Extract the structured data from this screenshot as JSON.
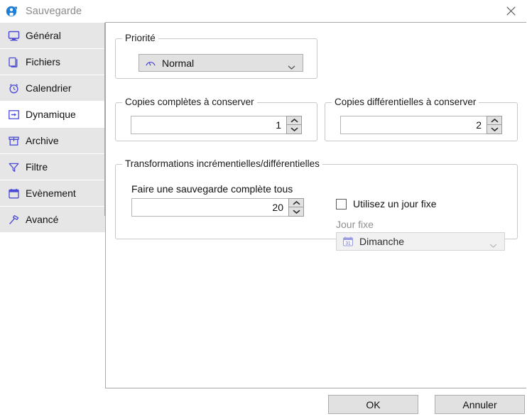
{
  "window": {
    "title": "Sauvegarde",
    "app_icon": "save-disk-icon",
    "close_icon": "close-icon"
  },
  "sidebar": {
    "items": [
      {
        "label": "Général",
        "icon": "monitor-icon",
        "selected": false
      },
      {
        "label": "Fichiers",
        "icon": "files-icon",
        "selected": false
      },
      {
        "label": "Calendrier",
        "icon": "alarm-clock-icon",
        "selected": false
      },
      {
        "label": "Dynamique",
        "icon": "arrow-box-icon",
        "selected": true
      },
      {
        "label": "Archive",
        "icon": "archive-box-icon",
        "selected": false
      },
      {
        "label": "Filtre",
        "icon": "funnel-icon",
        "selected": false
      },
      {
        "label": "Evènement",
        "icon": "calendar-icon",
        "selected": false
      },
      {
        "label": "Avancé",
        "icon": "hammer-icon",
        "selected": false
      }
    ]
  },
  "main": {
    "priority_group": {
      "title": "Priorité",
      "combo": {
        "value": "Normal",
        "icon": "gauge-icon",
        "arrow_icon": "chevron-down-icon"
      }
    },
    "full_copies_group": {
      "title": "Copies complètes à conserver",
      "spinner": {
        "value": "1",
        "up_icon": "chevron-up-icon",
        "down_icon": "chevron-down-icon"
      }
    },
    "diff_copies_group": {
      "title": "Copies différentielles à conserver",
      "spinner": {
        "value": "2",
        "up_icon": "chevron-up-icon",
        "down_icon": "chevron-down-icon"
      }
    },
    "transformations_group": {
      "title": "Transformations incrémentielles/différentielles",
      "full_backup_label": "Faire une sauvegarde complète tous",
      "full_backup_spinner": {
        "value": "20",
        "up_icon": "chevron-up-icon",
        "down_icon": "chevron-down-icon"
      },
      "fixed_day_checkbox": {
        "label": "Utilisez un jour fixe",
        "checked": false
      },
      "fixed_day_label": "Jour fixe",
      "fixed_day_combo": {
        "value": "Dimanche",
        "icon": "calendar-31-icon",
        "arrow_icon": "chevron-down-icon",
        "disabled": true
      }
    }
  },
  "footer": {
    "ok_label": "OK",
    "cancel_label": "Annuler"
  },
  "colors": {
    "accent": "#4a4ad6",
    "titlebar_text": "#8a8a8a",
    "sidebar_item_bg": "#e6e6e6",
    "sidebar_selected_bg": "#ffffff",
    "groupbox_border": "#c8c8c8",
    "button_bg": "#e1e1e1"
  }
}
